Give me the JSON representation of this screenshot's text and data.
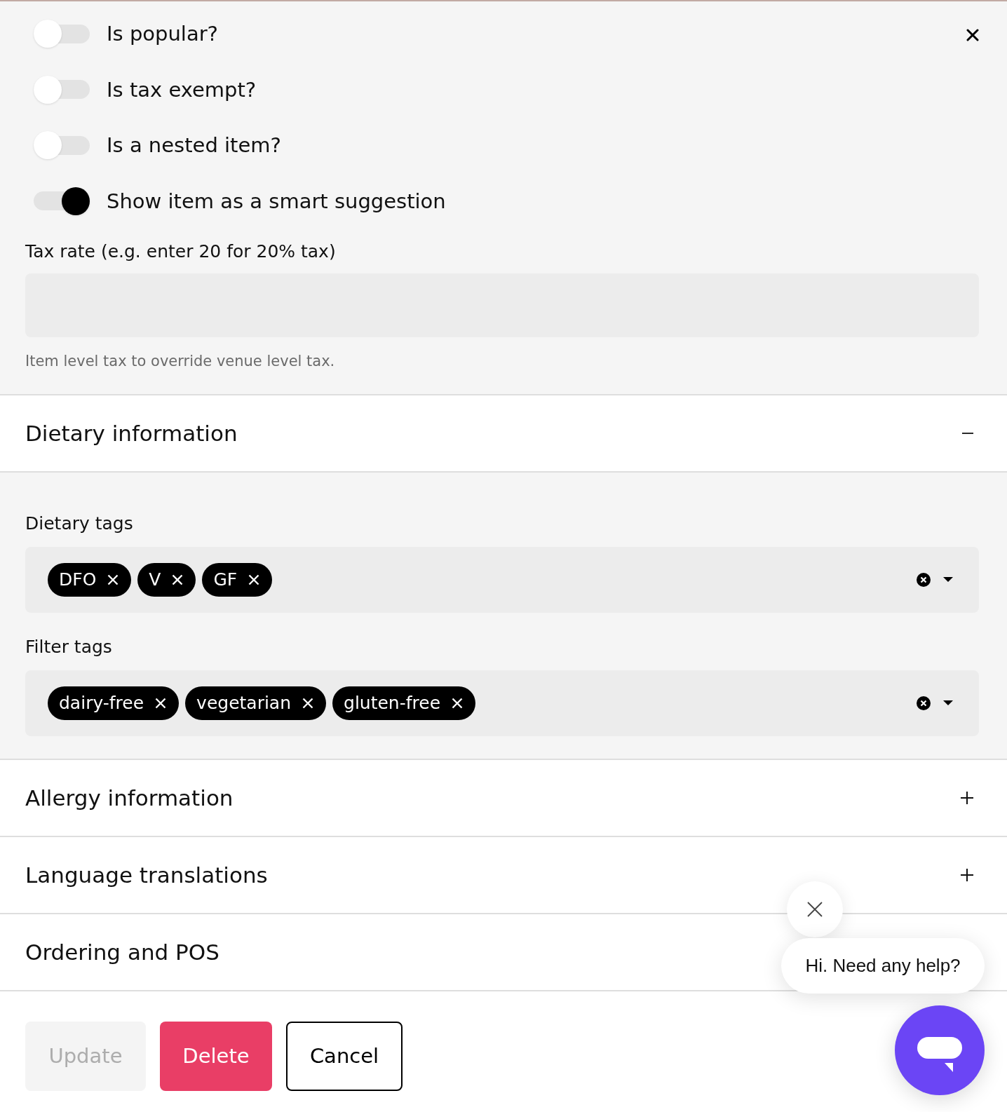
{
  "toggles": [
    {
      "label": "Is popular?",
      "on": false
    },
    {
      "label": "Is tax exempt?",
      "on": false
    },
    {
      "label": "Is a nested item?",
      "on": false
    },
    {
      "label": "Show item as a smart suggestion",
      "on": true
    }
  ],
  "tax_rate": {
    "label": "Tax rate (e.g. enter 20 for 20% tax)",
    "help": "Item level tax to override venue level tax."
  },
  "sections": [
    {
      "title": "Dietary information",
      "expanded": true,
      "fields": [
        {
          "label": "Dietary tags",
          "tags": [
            "DFO",
            "V",
            "GF"
          ]
        },
        {
          "label": "Filter tags",
          "tags": [
            "dairy-free",
            "vegetarian",
            "gluten-free"
          ]
        }
      ]
    },
    {
      "title": "Allergy information",
      "expanded": false
    },
    {
      "title": "Language translations",
      "expanded": false
    },
    {
      "title": "Ordering and POS"
    }
  ],
  "buttons": [
    {
      "label": "Update",
      "kind": "primary",
      "disabled": true
    },
    {
      "label": "Delete",
      "kind": "danger",
      "disabled": false
    },
    {
      "label": "Cancel",
      "kind": "outline",
      "disabled": false
    }
  ],
  "chat": {
    "message": "Hi. Need any help?"
  }
}
